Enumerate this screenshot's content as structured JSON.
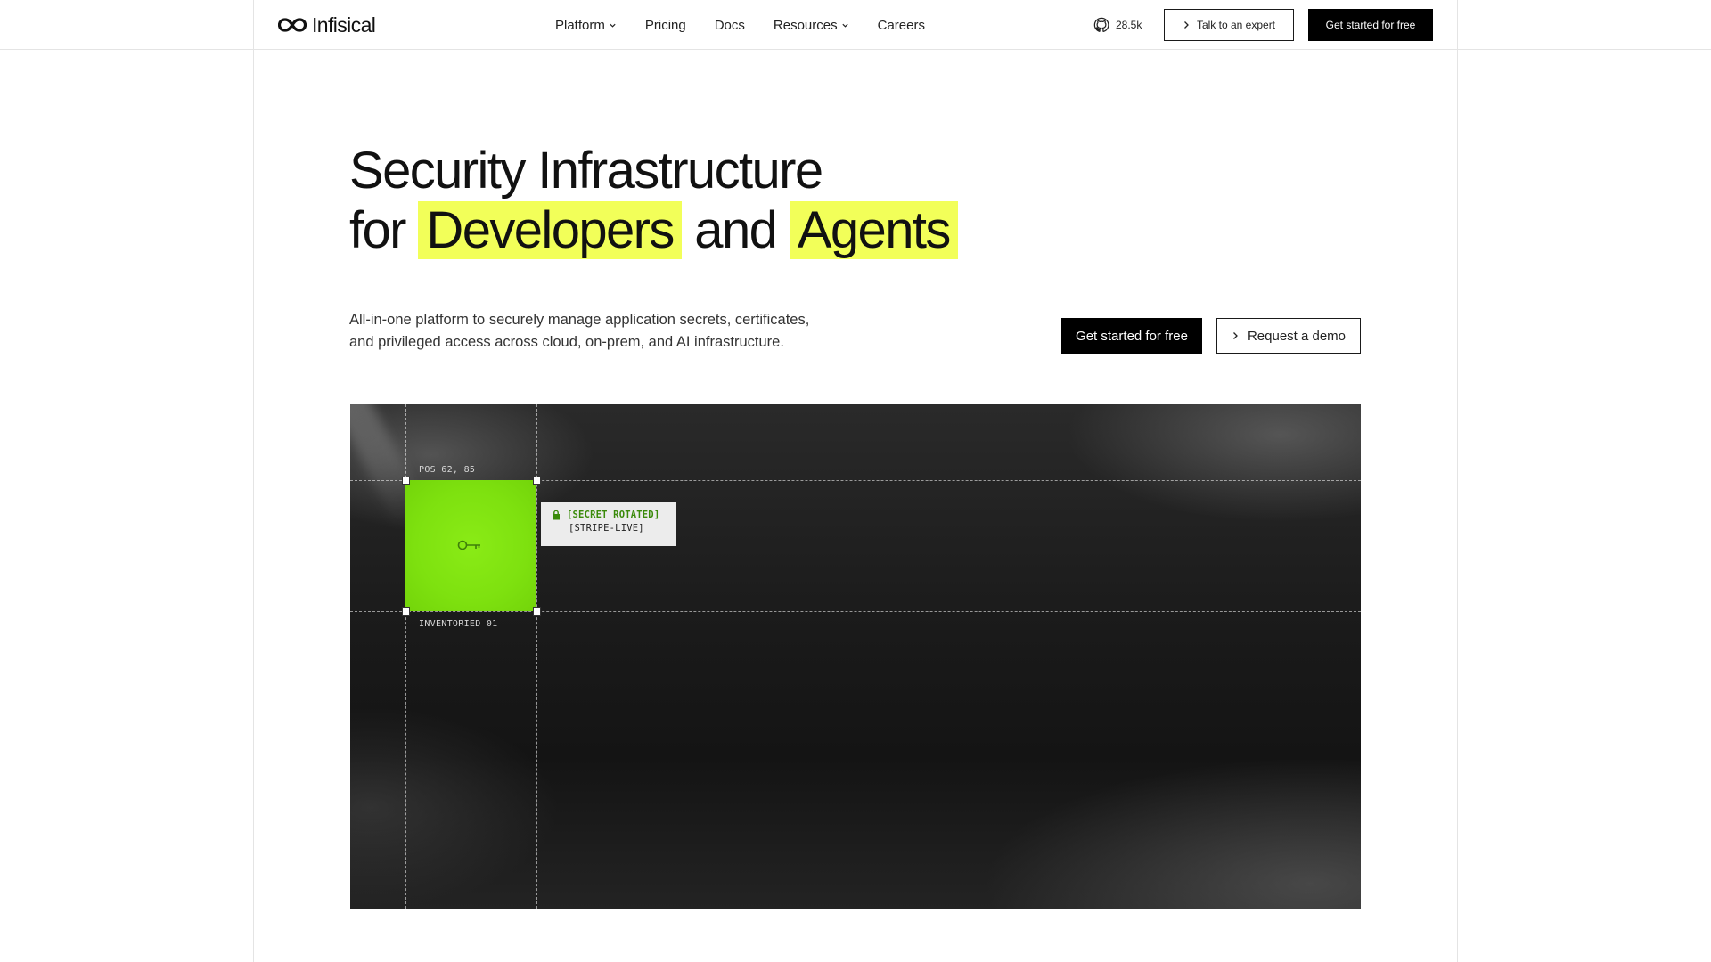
{
  "nav": {
    "logo_text": "Infisical",
    "links": [
      {
        "label": "Platform",
        "has_dropdown": true
      },
      {
        "label": "Pricing",
        "has_dropdown": false
      },
      {
        "label": "Docs",
        "has_dropdown": false
      },
      {
        "label": "Resources",
        "has_dropdown": true
      },
      {
        "label": "Careers",
        "has_dropdown": false
      }
    ],
    "github_stars": "28.5k",
    "talk_button": "Talk to an expert",
    "cta_button": "Get started for free"
  },
  "hero": {
    "title_line1": "Security Infrastructure",
    "title_for": "for",
    "title_highlight1": "Developers",
    "title_and": "and",
    "title_highlight2": "Agents",
    "subtitle_line1": "All-in-one platform to securely manage application secrets, certificates,",
    "subtitle_line2": "and privileged access across cloud, on-prem, and AI infrastructure.",
    "primary_button": "Get started for free",
    "secondary_button": "Request a demo"
  },
  "visual": {
    "pos_label": "POS 62, 85",
    "inventory_label": "INVENTORIED 01",
    "tooltip_status": "[SECRET ROTATED]",
    "tooltip_name": "[STRIPE-LIVE]"
  },
  "colors": {
    "highlight": "#f2ff59",
    "accent_green": "#7ee10f",
    "status_green": "#3a8a0a",
    "button_dark": "#000000"
  },
  "icons": [
    "infinity-logo-icon",
    "chevron-down-icon",
    "github-icon",
    "chevron-right-icon",
    "key-icon",
    "lock-icon"
  ]
}
